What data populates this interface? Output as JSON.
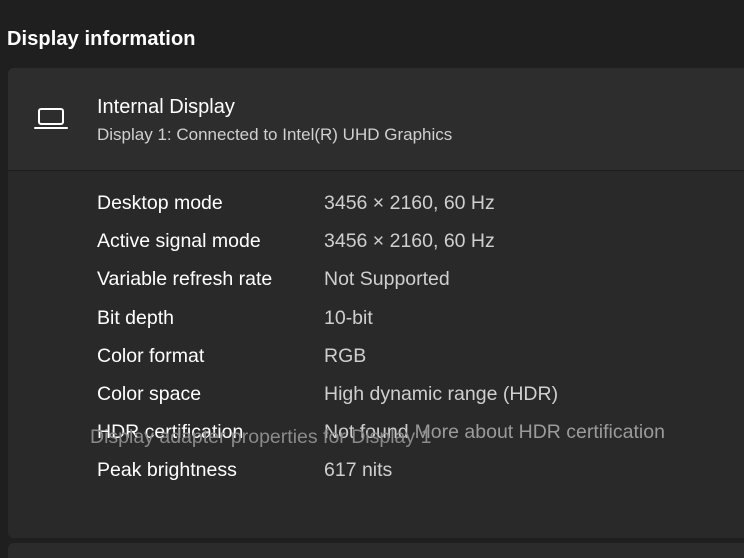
{
  "section_title": "Display information",
  "display": {
    "name": "Internal Display",
    "subtitle": "Display 1: Connected to Intel(R) UHD Graphics",
    "icon": "laptop-icon"
  },
  "details": [
    {
      "label": "Desktop mode",
      "value": "3456 × 2160, 60 Hz"
    },
    {
      "label": "Active signal mode",
      "value": "3456 × 2160, 60 Hz"
    },
    {
      "label": "Variable refresh rate",
      "value": "Not Supported"
    },
    {
      "label": "Bit depth",
      "value": "10-bit"
    },
    {
      "label": "Color format",
      "value": "RGB"
    },
    {
      "label": "Color space",
      "value": "High dynamic range (HDR)"
    },
    {
      "label": "HDR certification",
      "value": "Not found",
      "link": "More about HDR certification"
    },
    {
      "label": "Peak brightness",
      "value": "617 nits"
    }
  ],
  "adapter_link": "Display adapter properties for Display 1",
  "colors": {
    "background": "#1f1f1f",
    "card": "#2b2b2b",
    "link": "#9b9b9b"
  }
}
